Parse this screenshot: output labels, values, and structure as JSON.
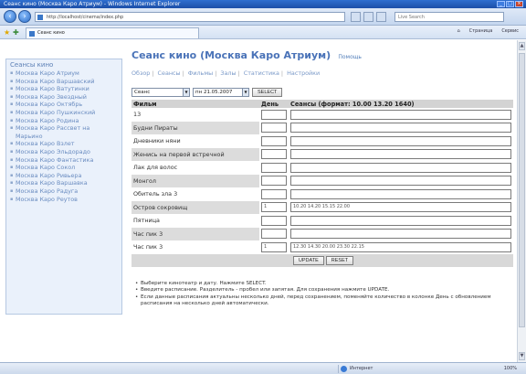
{
  "browser": {
    "title": "Сеанс кино (Москва Каро Атриум) - Windows Internet Explorer",
    "address": "http://localhost/cinema/index.php",
    "tab_label": "Сеанс кино",
    "search_placeholder": "Live Search",
    "commands": [
      "Страница",
      "Сервис"
    ],
    "zone": "Интернет",
    "zoom": "100%"
  },
  "sidebar": {
    "title": "Сеансы кино",
    "items": [
      "Москва Каро Атриум",
      "Москва Каро Варшавский",
      "Москва Каро Ватутинки",
      "Москва Каро Звездный",
      "Москва Каро Октябрь",
      "Москва Каро Пушкинский",
      "Москва Каро Родина",
      "Москва Каро Рассвет на Марьино",
      "Москва Каро Взлет",
      "Москва Каро Эльдорадо",
      "Москва Каро Фантастика",
      "Москва Каро Сокол",
      "Москва Каро Ривьера",
      "Москва Каро Варшавка",
      "Москва Каро Радуга",
      "Москва Каро Реутов"
    ]
  },
  "main": {
    "title": "Сеанс кино (Москва Каро Атриум)",
    "help": "Помощь",
    "links": [
      "Обзор",
      "Сеансы",
      "Фильмы",
      "Залы",
      "Статистика",
      "Настройки"
    ]
  },
  "filter": {
    "cinema_value": "Сеанс",
    "date_value": "пн 21.05.2007",
    "select_label": "SELECT"
  },
  "table": {
    "headers": [
      "Фильм",
      "День",
      "Сеансы (формат: 10.00 13.20 1640)"
    ],
    "rows": [
      {
        "film": "13",
        "day": "",
        "sessions": ""
      },
      {
        "film": "Будни Пираты",
        "day": "",
        "sessions": ""
      },
      {
        "film": "Дневники няни",
        "day": "",
        "sessions": ""
      },
      {
        "film": "Женись на первой встречной",
        "day": "",
        "sessions": ""
      },
      {
        "film": "Лак для волос",
        "day": "",
        "sessions": ""
      },
      {
        "film": "Монгол",
        "day": "",
        "sessions": ""
      },
      {
        "film": "Обитель зла 3",
        "day": "",
        "sessions": ""
      },
      {
        "film": "Остров сокровищ",
        "day": "1",
        "sessions": "10.20 14.20 15.15 22.00"
      },
      {
        "film": "Пятница",
        "day": "",
        "sessions": ""
      },
      {
        "film": "Час пик 3",
        "day": "",
        "sessions": ""
      },
      {
        "film": "Час пик 3",
        "day": "1",
        "sessions": "12.30 14.30 20.00 23.30 22.15"
      }
    ],
    "update_label": "UPDATE",
    "reset_label": "RESET"
  },
  "notes": [
    "Выберите кинотеатр и дату. Нажмите SELECT.",
    "Введите расписание. Разделитель - пробел или запятая. Для сохранения нажмите UPDATE.",
    "Если данные расписания актуальны несколько дней, перед сохранением, поменяйте количество в колонке День с обновлением расписания на несколько дней автоматически."
  ]
}
